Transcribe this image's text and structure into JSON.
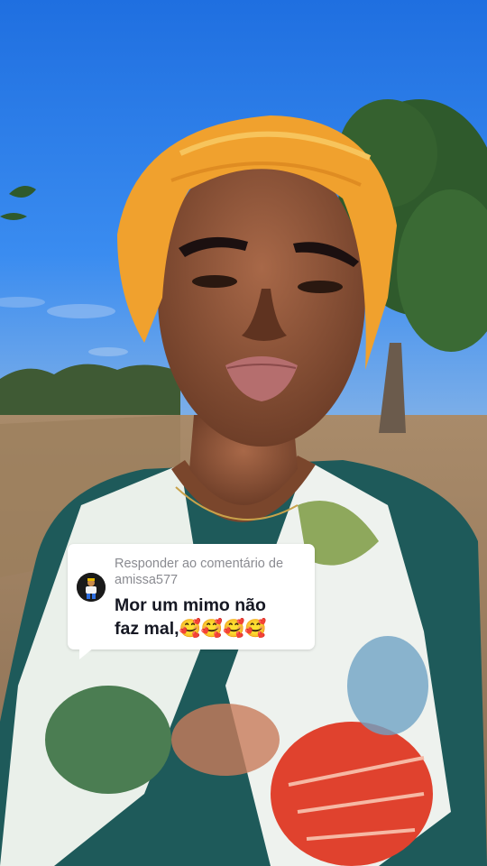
{
  "reply_sticker": {
    "header_line1": "Responder ao comentário de",
    "username": "amissa577",
    "comment_line1": "Mor um mimo não",
    "comment_line2_text": "faz mal,",
    "comment_line2_emojis": "🥰🥰🥰🥰"
  },
  "colors": {
    "sky": "#2a7be6",
    "headscarf": "#f0a12e",
    "card_bg": "#ffffff",
    "header_text": "#8a8b91",
    "comment_text": "#161823"
  }
}
